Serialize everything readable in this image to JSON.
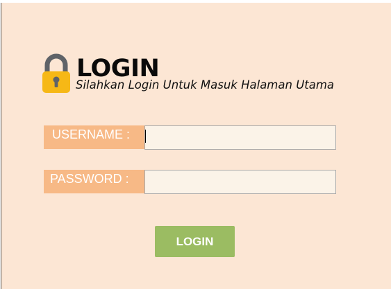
{
  "header": {
    "icon": "padlock-icon",
    "title": "LOGIN",
    "subtitle": "Silahkan Login Untuk Masuk Halaman Utama"
  },
  "form": {
    "username_label": "USERNAME :",
    "username_value": "",
    "password_label": "PASSWORD :",
    "password_value": "",
    "submit_label": "LOGIN"
  },
  "colors": {
    "background": "#fce6d4",
    "label_bg": "#f7b986",
    "input_bg": "#fbf3e8",
    "button_bg": "#9bbc62",
    "lock_shackle": "#5f6368",
    "lock_body": "#f6b816"
  }
}
